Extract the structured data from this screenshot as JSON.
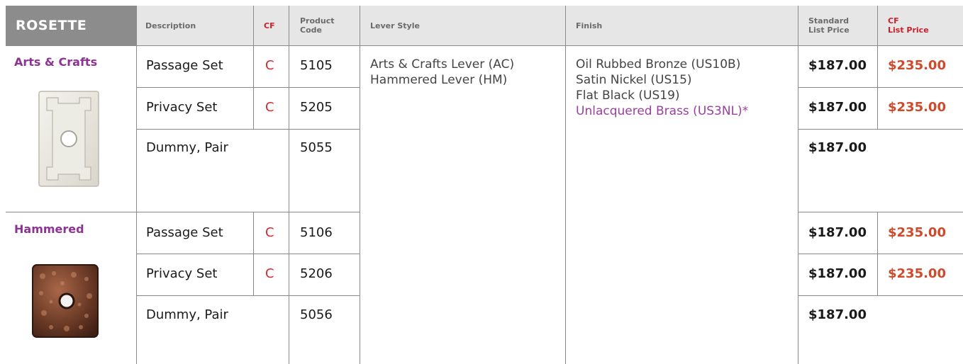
{
  "header": {
    "title": "ROSETTE",
    "description": "Description",
    "cf": "CF",
    "product_code_1": "Product",
    "product_code_2": "Code",
    "lever_style": "Lever Style",
    "finish": "Finish",
    "std_price_1": "Standard",
    "std_price_2": "List Price",
    "cf_price_1": "CF",
    "cf_price_2": "List Price"
  },
  "groups": [
    {
      "name": "Arts & Crafts",
      "image": "arts-crafts-rosette",
      "rows": [
        {
          "description": "Passage Set",
          "cf": "C",
          "code": "5105",
          "std_price": "$187.00",
          "cf_price": "$235.00"
        },
        {
          "description": "Privacy Set",
          "cf": "C",
          "code": "5205",
          "std_price": "$187.00",
          "cf_price": "$235.00"
        },
        {
          "description": "Dummy, Pair",
          "cf": "",
          "code": "5055",
          "std_price": "$187.00",
          "cf_price": ""
        }
      ]
    },
    {
      "name": "Hammered",
      "image": "hammered-rosette",
      "rows": [
        {
          "description": "Passage Set",
          "cf": "C",
          "code": "5106",
          "std_price": "$187.00",
          "cf_price": "$235.00"
        },
        {
          "description": "Privacy Set",
          "cf": "C",
          "code": "5206",
          "std_price": "$187.00",
          "cf_price": "$235.00"
        },
        {
          "description": "Dummy, Pair",
          "cf": "",
          "code": "5056",
          "std_price": "$187.00",
          "cf_price": ""
        }
      ]
    }
  ],
  "lever_styles": [
    "Arts & Crafts Lever (AC)",
    "Hammered Lever (HM)"
  ],
  "finishes": [
    "Oil Rubbed Bronze (US10B)",
    "Satin Nickel (US15)",
    "Flat Black (US19)",
    "Unlacquered Brass (US3NL)*"
  ],
  "colors": {
    "header_bg": "#e6e6e6",
    "title_bg": "#8c8c8c",
    "category": "#8e3393",
    "cf_red": "#d12a2f",
    "cf_price": "#cf4a2a",
    "unlacquered": "#9a3fa0"
  }
}
